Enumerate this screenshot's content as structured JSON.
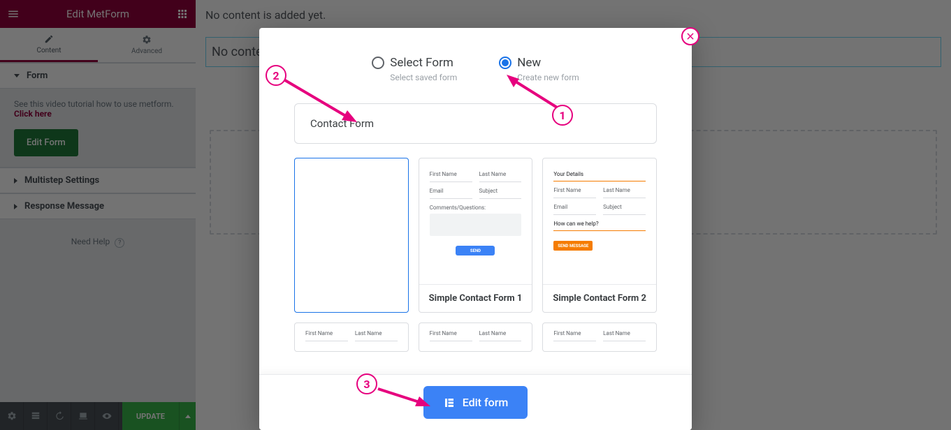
{
  "panel": {
    "title": "Edit MetForm",
    "tabs": {
      "content": "Content",
      "advanced": "Advanced"
    },
    "form_section": {
      "title": "Form",
      "hint": "See this video tutorial how to use metform. ",
      "hint_link": "Click here",
      "edit_btn": "Edit Form"
    },
    "multistep_title": "Multistep Settings",
    "response_title": "Response Message",
    "need_help": "Need Help",
    "update_btn": "UPDATE"
  },
  "canvas": {
    "no_content_bar": "No content is added yet.",
    "widget_placeholder": "No content"
  },
  "modal": {
    "select_label": "Select Form",
    "select_sub": "Select saved form",
    "new_label": "New",
    "new_sub": "Create new form",
    "form_name": "Contact Form",
    "templates": [
      {
        "id": "blank",
        "title": ""
      },
      {
        "id": "simple1",
        "title": "Simple Contact Form 1"
      },
      {
        "id": "simple2",
        "title": "Simple Contact Form 2"
      }
    ],
    "preview_labels": {
      "first": "First Name",
      "last": "Last Name",
      "email": "Email",
      "subject": "Subject",
      "comments": "Comments/Questions:",
      "send": "SEND",
      "your_details": "Your Details",
      "help": "How can we help?",
      "send_msg": "SEND MESSAGE"
    },
    "footer_btn": "Edit form"
  },
  "callouts": {
    "c1": "1",
    "c2": "2",
    "c3": "3"
  }
}
